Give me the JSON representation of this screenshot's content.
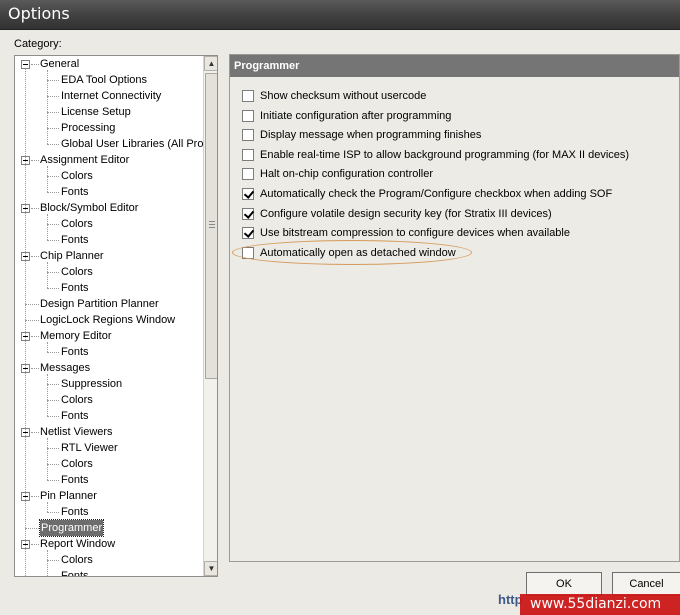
{
  "window": {
    "title": "Options"
  },
  "category_label": "Category:",
  "tree": {
    "items": [
      {
        "label": "General",
        "level": 0,
        "expanded": true
      },
      {
        "label": "EDA Tool Options",
        "level": 1
      },
      {
        "label": "Internet Connectivity",
        "level": 1
      },
      {
        "label": "License Setup",
        "level": 1
      },
      {
        "label": "Processing",
        "level": 1
      },
      {
        "label": "Global User Libraries (All Proje",
        "level": 1
      },
      {
        "label": "Assignment Editor",
        "level": 0,
        "expanded": true
      },
      {
        "label": "Colors",
        "level": 1
      },
      {
        "label": "Fonts",
        "level": 1
      },
      {
        "label": "Block/Symbol Editor",
        "level": 0,
        "expanded": true
      },
      {
        "label": "Colors",
        "level": 1
      },
      {
        "label": "Fonts",
        "level": 1
      },
      {
        "label": "Chip Planner",
        "level": 0,
        "expanded": true
      },
      {
        "label": "Colors",
        "level": 1
      },
      {
        "label": "Fonts",
        "level": 1
      },
      {
        "label": "Design Partition Planner",
        "level": 0
      },
      {
        "label": "LogicLock Regions Window",
        "level": 0
      },
      {
        "label": "Memory Editor",
        "level": 0,
        "expanded": true
      },
      {
        "label": "Fonts",
        "level": 1
      },
      {
        "label": "Messages",
        "level": 0,
        "expanded": true
      },
      {
        "label": "Suppression",
        "level": 1
      },
      {
        "label": "Colors",
        "level": 1
      },
      {
        "label": "Fonts",
        "level": 1
      },
      {
        "label": "Netlist Viewers",
        "level": 0,
        "expanded": true
      },
      {
        "label": "RTL Viewer",
        "level": 1
      },
      {
        "label": "Colors",
        "level": 1
      },
      {
        "label": "Fonts",
        "level": 1
      },
      {
        "label": "Pin Planner",
        "level": 0,
        "expanded": true
      },
      {
        "label": "Fonts",
        "level": 1
      },
      {
        "label": "Programmer",
        "level": 0,
        "selected": true
      },
      {
        "label": "Report Window",
        "level": 0,
        "expanded": true
      },
      {
        "label": "Colors",
        "level": 1
      },
      {
        "label": "Fonts",
        "level": 1
      }
    ]
  },
  "panel": {
    "title": "Programmer",
    "options": [
      {
        "label": "Show checksum without usercode",
        "checked": false
      },
      {
        "label": "Initiate configuration after programming",
        "checked": false
      },
      {
        "label": "Display message when programming finishes",
        "checked": false
      },
      {
        "label": "Enable real-time ISP to allow background programming (for MAX II devices)",
        "checked": false
      },
      {
        "label": "Halt on-chip configuration controller",
        "checked": false
      },
      {
        "label": "Automatically check the Program/Configure checkbox when adding SOF",
        "checked": true
      },
      {
        "label": "Configure volatile design security key (for Stratix III devices)",
        "checked": true
      },
      {
        "label": "Use bitstream compression to configure devices when available",
        "checked": true
      },
      {
        "label": "Automatically open as detached window",
        "checked": false,
        "highlighted": true
      }
    ]
  },
  "buttons": {
    "ok": "OK",
    "cancel": "Cancel"
  },
  "watermark": {
    "link_text": "http",
    "site": "www.55dianzi.com"
  },
  "colors": {
    "titlebar": "#3e3e3e",
    "panel_header": "#757575",
    "selected_item": "#6d6d6d",
    "highlight_ellipse": "#d49a5a",
    "watermark": "#cc1313"
  }
}
